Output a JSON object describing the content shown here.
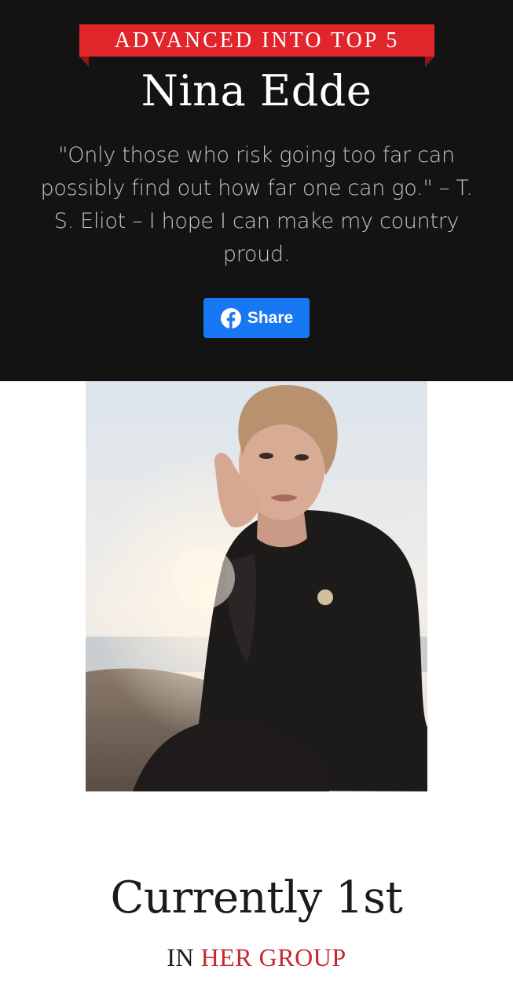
{
  "badge": {
    "text": "ADVANCED INTO TOP 5"
  },
  "contestant": {
    "name": "Nina Edde",
    "quote": "\"Only those who risk going too far can possibly find out how far one can go.\" – T. S. Eliot – I hope I can make my country proud."
  },
  "share_button": {
    "icon": "facebook-icon",
    "label": "Share"
  },
  "photo": {
    "alt": "Nina Edde"
  },
  "ranking": {
    "title": "Currently 1st",
    "prefix": "IN",
    "highlight": "HER GROUP"
  },
  "colors": {
    "hero_background": "#131313",
    "ribbon": "#e0262b",
    "facebook_blue": "#1877f2",
    "highlight_red": "#c9272c"
  }
}
